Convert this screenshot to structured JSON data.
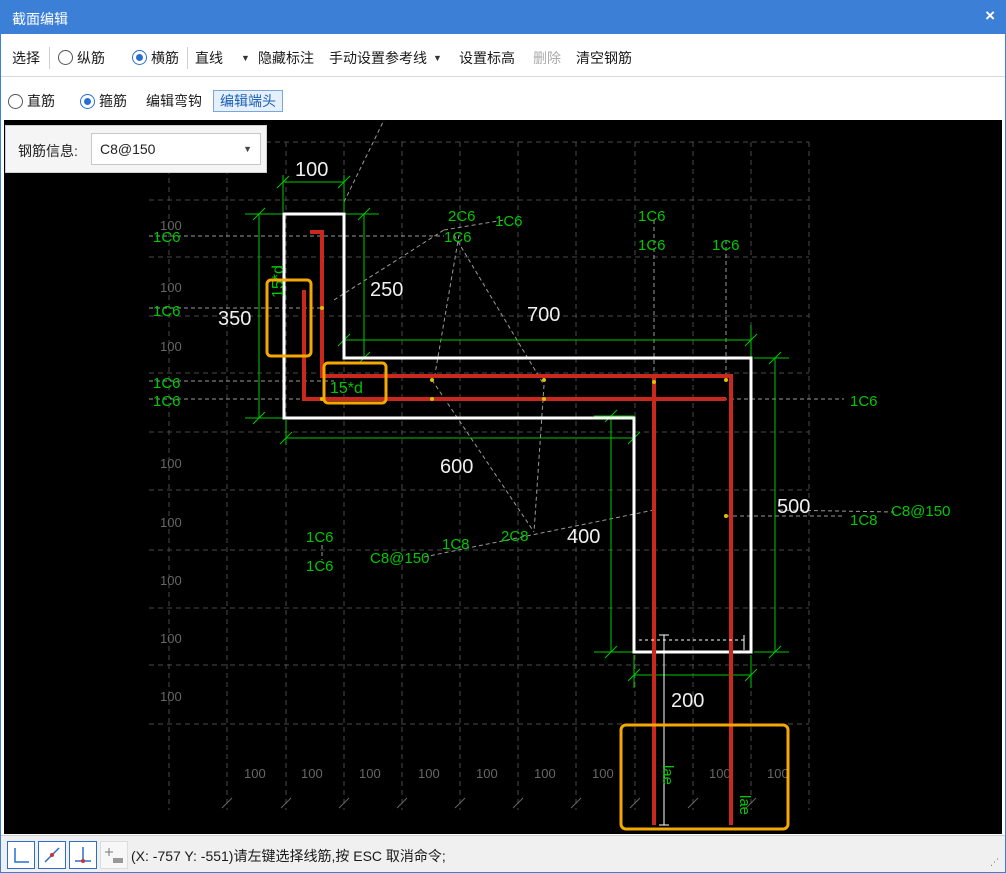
{
  "window": {
    "title": "截面编辑",
    "close": "×"
  },
  "toolbar1": {
    "select": "选择",
    "longitudinal": "纵筋",
    "transverse": "横筋",
    "line_type": "直线",
    "hide_labels": "隐藏标注",
    "manual_ref": "手动设置参考线",
    "set_elevation": "设置标高",
    "delete": "删除",
    "clear_rebar": "清空钢筋"
  },
  "toolbar2": {
    "straight": "直筋",
    "stirrup": "箍筋",
    "edit_hook": "编辑弯钩",
    "edit_end": "编辑端头"
  },
  "rebar_info": {
    "label": "钢筋信息:",
    "value": "C8@150"
  },
  "dims": {
    "d100": "100",
    "d250": "250",
    "d350": "350",
    "d700": "700",
    "d600": "600",
    "d500": "500",
    "d400": "400",
    "d200": "200",
    "hook": "15*d",
    "lae": "lae"
  },
  "grid_labels": {
    "g100": "100"
  },
  "rebar_labels": {
    "c6": "1C6",
    "c6x2": "2C6",
    "c8": "1C8",
    "c8x2": "2C8",
    "stirrup": "C8@150"
  },
  "status": {
    "text": "(X: -757 Y: -551)请左键选择线筋,按 ESC 取消命令;"
  },
  "colors": {
    "rebar": "#c8281e",
    "outline": "#ffffff",
    "annot": "#00c800",
    "highlight": "#f5a800"
  }
}
